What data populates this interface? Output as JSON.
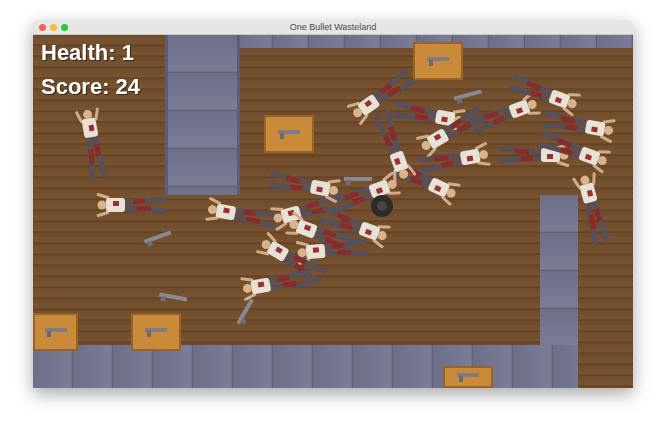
{
  "window": {
    "title": "One Bullet Wasteland"
  },
  "hud": {
    "health": "Health: 1",
    "score": "Score: 24"
  }
}
